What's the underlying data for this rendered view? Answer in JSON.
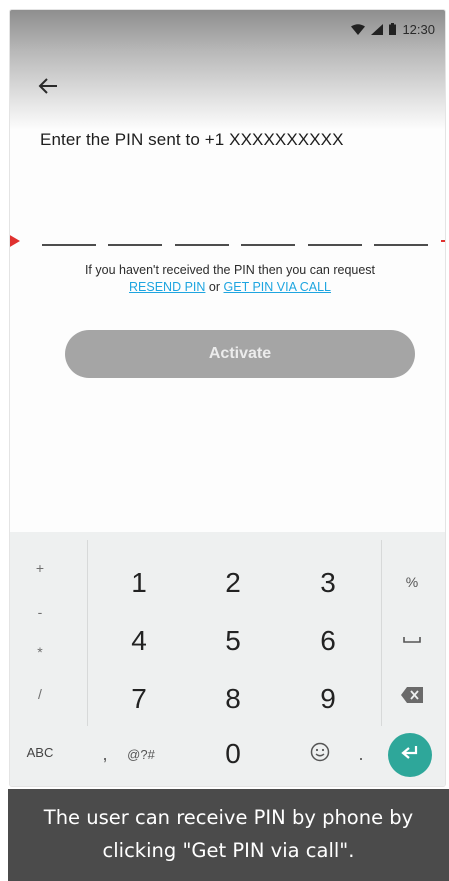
{
  "status_bar": {
    "time": "12:30",
    "icons": [
      "wifi-icon",
      "signal-icon",
      "battery-icon"
    ]
  },
  "header": {
    "back_icon": "arrow-left-icon",
    "title": "Enter the PIN sent to +1 XXXXXXXXXX"
  },
  "pin_entry": {
    "digit_count": 6
  },
  "resend": {
    "prefix": "If you haven't received the PIN then you can request",
    "resend_link": "RESEND PIN",
    "or_text": "or",
    "call_link": "GET PIN VIA CALL"
  },
  "activate_button": {
    "label": "Activate",
    "enabled": false,
    "color": "#a5a5a5"
  },
  "keyboard": {
    "left_keys": [
      "+",
      "-",
      "*",
      "/"
    ],
    "abc_label": "ABC",
    "rows": [
      [
        "1",
        "2",
        "3"
      ],
      [
        "4",
        "5",
        "6"
      ],
      [
        "7",
        "8",
        "9"
      ]
    ],
    "bottom": {
      "comma": ",",
      "symbols": "@?#",
      "zero": "0",
      "period": "."
    },
    "right_keys": {
      "percent": "%",
      "space_icon": "space-bar-icon",
      "backspace_icon": "backspace-icon",
      "enter_icon": "enter-icon"
    },
    "emoji_icon": "smiley-icon",
    "enter_color": "#2ea79a"
  },
  "caption": {
    "text": "The user can receive PIN by phone by clicking \"Get PIN via call\"."
  }
}
